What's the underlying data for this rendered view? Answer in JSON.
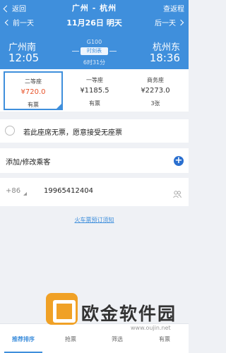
{
  "header": {
    "back_label": "返回",
    "route_title": "广州 - 杭州",
    "return_label": "查返程"
  },
  "datebar": {
    "prev_label": "前一天",
    "date_text": "11月26日  明天",
    "next_label": "后一天"
  },
  "trip": {
    "from_station": "广州南",
    "to_station": "杭州东",
    "dep_time": "12:05",
    "arr_time": "18:36",
    "train_no": "G100",
    "timetable_label": "时刻表",
    "duration": "6时31分"
  },
  "seats": [
    {
      "name": "二等座",
      "price": "¥720.0",
      "avail": "有票",
      "selected": true
    },
    {
      "name": "一等座",
      "price": "¥1185.5",
      "avail": "有票",
      "selected": false
    },
    {
      "name": "商务座",
      "price": "¥2273.0",
      "avail": "3张",
      "selected": false
    }
  ],
  "no_seat": {
    "text": "若此座席无票，愿意接受无座票"
  },
  "passenger": {
    "label": "添加/修改乘客",
    "add_icon": "+"
  },
  "phone": {
    "country_code": "+86",
    "number": "19965412404"
  },
  "notice": {
    "text": "火车票预订须知"
  },
  "tabs": [
    {
      "label": "推荐排序",
      "active": true
    },
    {
      "label": "抢票",
      "active": false
    },
    {
      "label": "筛选",
      "active": false
    },
    {
      "label": "有票",
      "active": false
    }
  ],
  "watermark": {
    "text": "欧金软件园",
    "url": "www.oujin.net"
  },
  "colors": {
    "brand_blue": "#3f8fdc",
    "price_red": "#e8532a"
  }
}
